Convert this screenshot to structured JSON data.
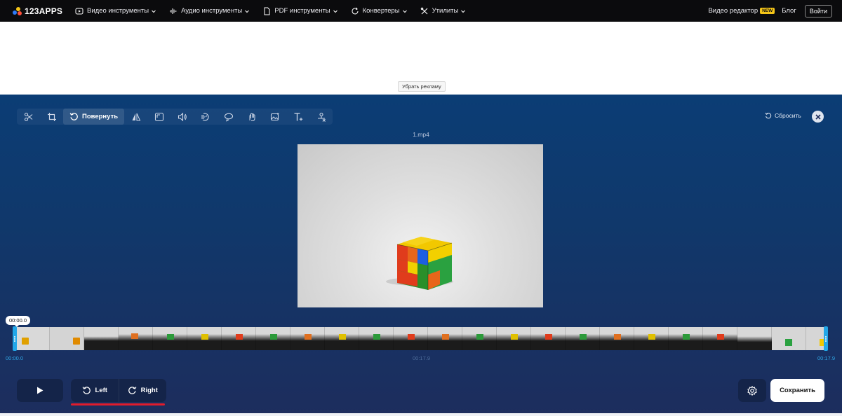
{
  "brand": {
    "name": "123APPS"
  },
  "nav": {
    "items": [
      {
        "label": "Видео инструменты",
        "icon": "play-circle-icon"
      },
      {
        "label": "Аудио инструменты",
        "icon": "waveform-icon"
      },
      {
        "label": "PDF инструменты",
        "icon": "document-icon"
      },
      {
        "label": "Конвертеры",
        "icon": "convert-icon"
      },
      {
        "label": "Утилиты",
        "icon": "tools-icon"
      }
    ],
    "video_editor": "Видео редактор",
    "new_badge": "NEW",
    "blog": "Блог",
    "login": "Войти"
  },
  "ad": {
    "remove_label": "Убрать рекламу"
  },
  "toolbar": {
    "active_tool": "Повернуть",
    "tools": [
      "cut-icon",
      "crop-icon",
      "rotate-icon",
      "flip-icon",
      "resize-icon",
      "volume-icon",
      "speed-icon",
      "loop-icon",
      "stabilize-icon",
      "image-icon",
      "text-icon",
      "remove-logo-icon"
    ],
    "reset_label": "Сбросить"
  },
  "file": {
    "name": "1.mp4"
  },
  "timeline": {
    "current_time": "00:00.0",
    "start_time": "00:00.0",
    "mid_time": "00:17.9",
    "end_time": "00:17.9"
  },
  "controls": {
    "rotate_left": "Left",
    "rotate_right": "Right",
    "save": "Сохранить"
  },
  "colors": {
    "accent": "#22a7e8",
    "highlight": "#e01c2c",
    "new_badge": "#f5c518"
  }
}
